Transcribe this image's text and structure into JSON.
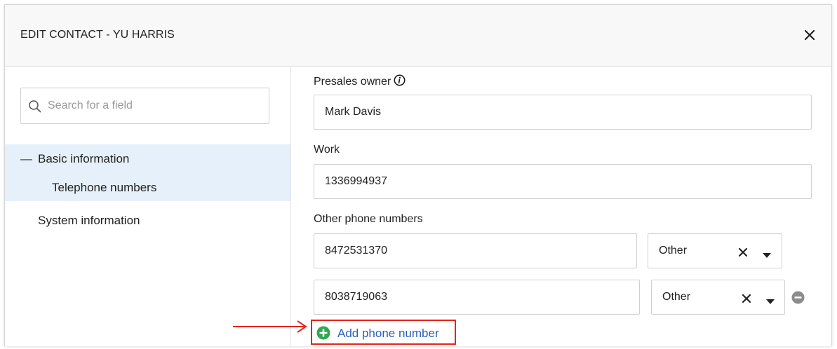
{
  "dialog": {
    "title": "EDIT CONTACT - YU HARRIS",
    "close_icon": "close-icon"
  },
  "sidebar": {
    "search": {
      "placeholder": "Search for a field",
      "value": "",
      "icon": "search-icon"
    },
    "nav": {
      "group_label": "Basic information",
      "group_collapse_symbol": "—",
      "sub_item_label": "Telephone numbers",
      "other_label": "System information",
      "selected_bg": "#e5f0fa"
    }
  },
  "form": {
    "presales_owner": {
      "label": "Presales owner",
      "value": "Mark Davis",
      "info_icon": "info-icon"
    },
    "work": {
      "label": "Work",
      "value": "1336994937"
    },
    "other_phones": {
      "label": "Other phone numbers",
      "rows": [
        {
          "number": "8472531370",
          "type": "Other"
        },
        {
          "number": "8038719063",
          "type": "Other"
        }
      ]
    },
    "add_phone": {
      "label": "Add phone number",
      "icon": "plus-circle-icon",
      "icon_color": "#2fa84f",
      "link_color": "#2b5fbd",
      "highlight_color": "#e4241c"
    }
  }
}
